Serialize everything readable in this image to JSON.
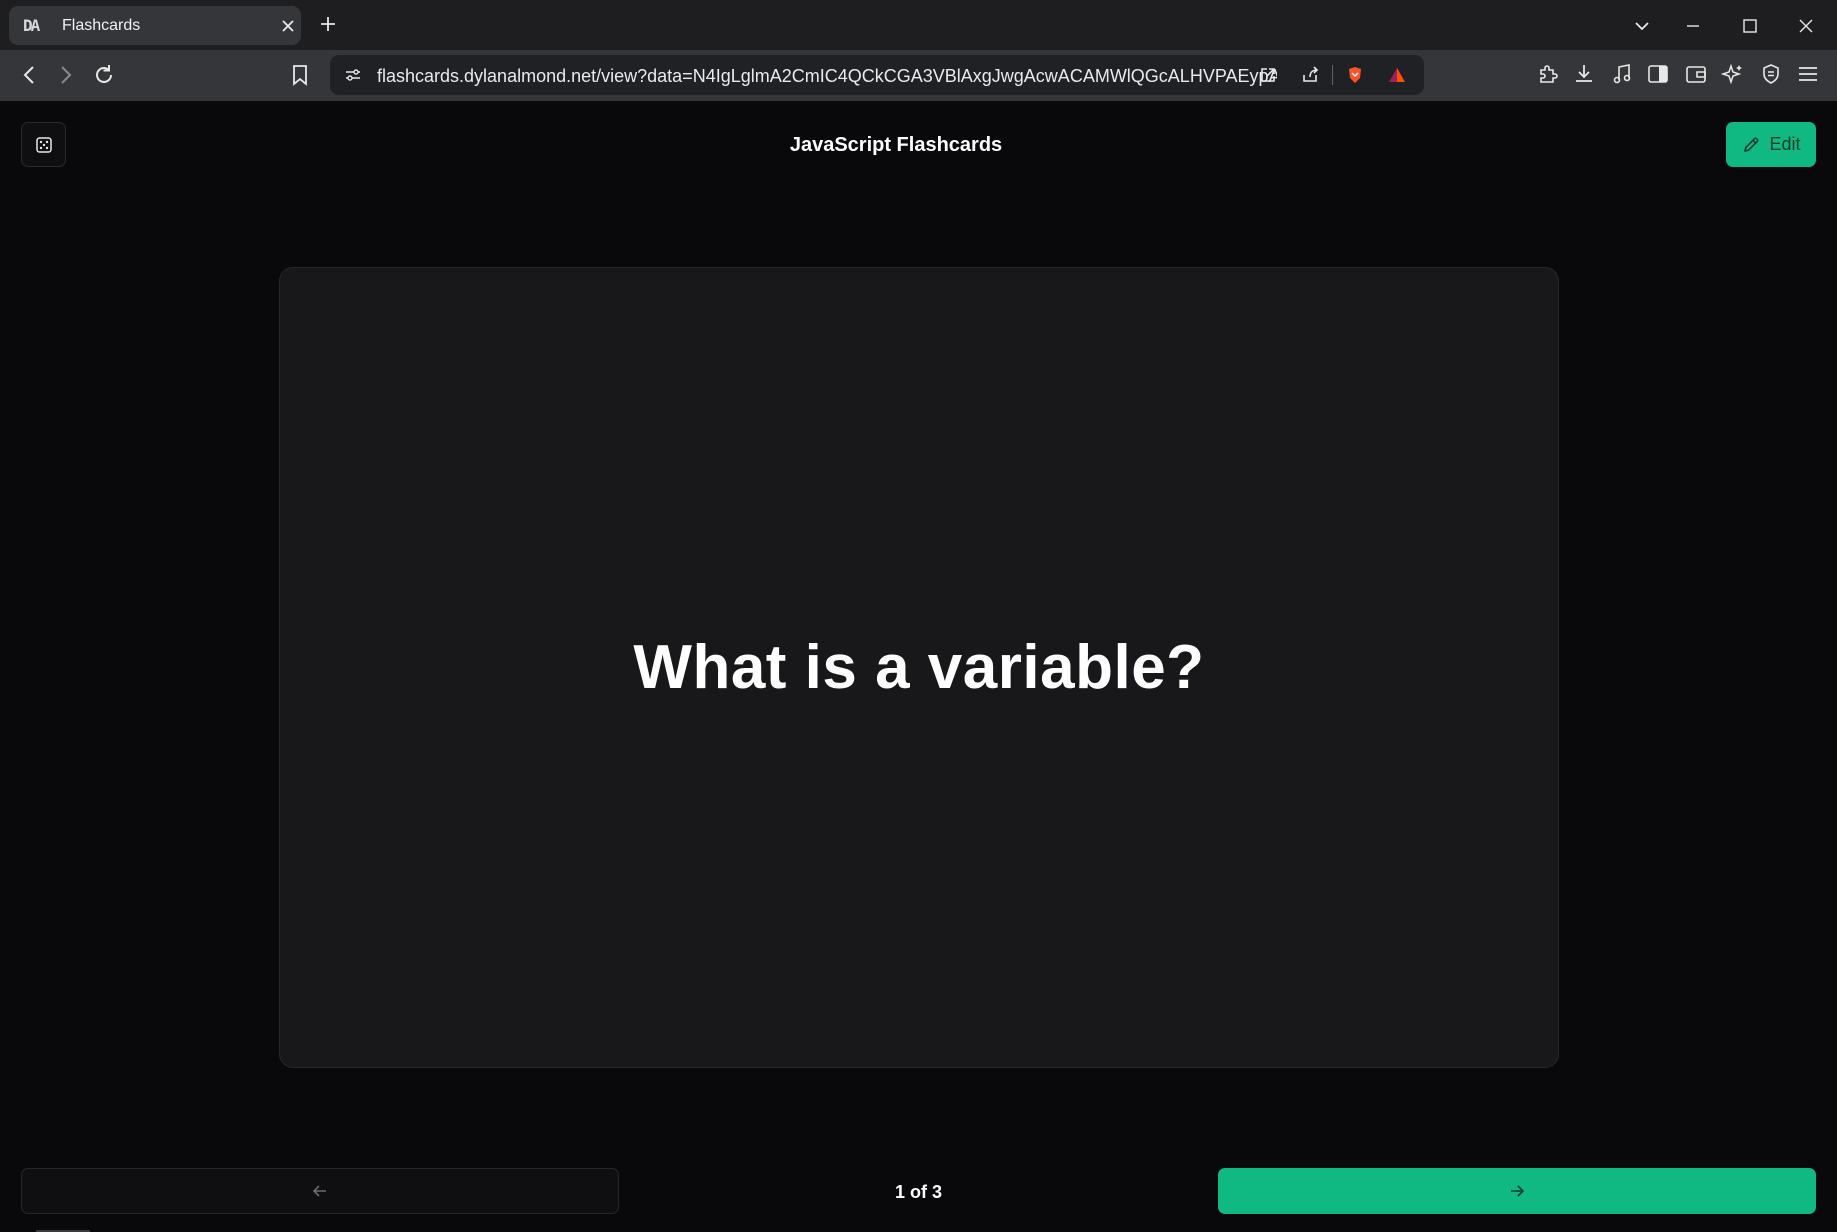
{
  "browser": {
    "tab": {
      "favicon_text": "DA",
      "title": "Flashcards"
    },
    "url": "flashcards.dylanalmond.net/view?data=N4IgLglmA2CmIC4QCkCGA3VBlAxgJwgAcwACAMWlQGcALHVPAEypA..."
  },
  "page": {
    "deck_title": "JavaScript Flashcards",
    "edit_label": "Edit",
    "card_text": "What is a variable?",
    "counter": "1 of 3"
  },
  "colors": {
    "accent": "#10b981",
    "background": "#09090b",
    "card": "#18181b"
  },
  "icons": {
    "shuffle": "dice-icon",
    "edit": "pencil-icon",
    "prev": "arrow-left-icon",
    "next": "arrow-right-icon"
  }
}
